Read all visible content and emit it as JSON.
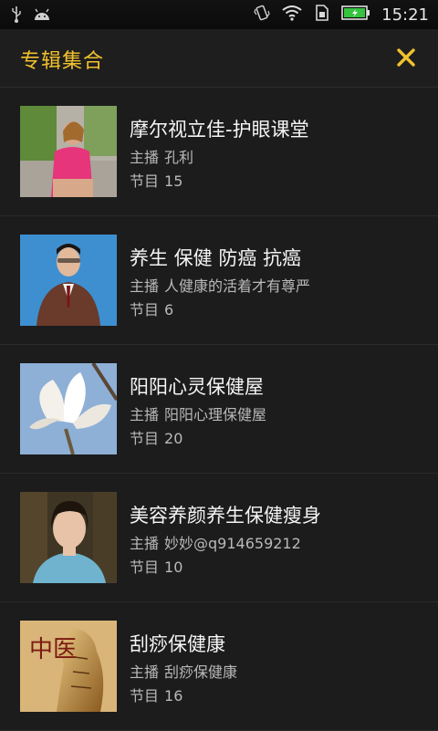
{
  "statusbar": {
    "time": "15:21",
    "icons": [
      "usb-icon",
      "android-icon",
      "vibrate-icon",
      "wifi-icon",
      "sim-icon",
      "battery-icon"
    ]
  },
  "header": {
    "title": "专辑集合",
    "close_icon": "close-icon",
    "accent": "#f2c12e"
  },
  "albums": [
    {
      "title": "摩尔视立佳-护眼课堂",
      "host_label": "主播",
      "host": "孔利",
      "count_label": "节目",
      "count": "15"
    },
    {
      "title": "养生 保健 防癌 抗癌",
      "host_label": "主播",
      "host": "人健康的活着才有尊严",
      "count_label": "节目",
      "count": "6"
    },
    {
      "title": "阳阳心灵保健屋",
      "host_label": "主播",
      "host": "阳阳心理保健屋",
      "count_label": "节目",
      "count": "20"
    },
    {
      "title": "美容养颜养生保健瘦身",
      "host_label": "主播",
      "host": "妙妙@q914659212",
      "count_label": "节目",
      "count": "10"
    },
    {
      "title": "刮痧保健康",
      "host_label": "主播",
      "host": "刮痧保健康",
      "count_label": "节目",
      "count": "16",
      "thumb_text": "中医"
    }
  ]
}
